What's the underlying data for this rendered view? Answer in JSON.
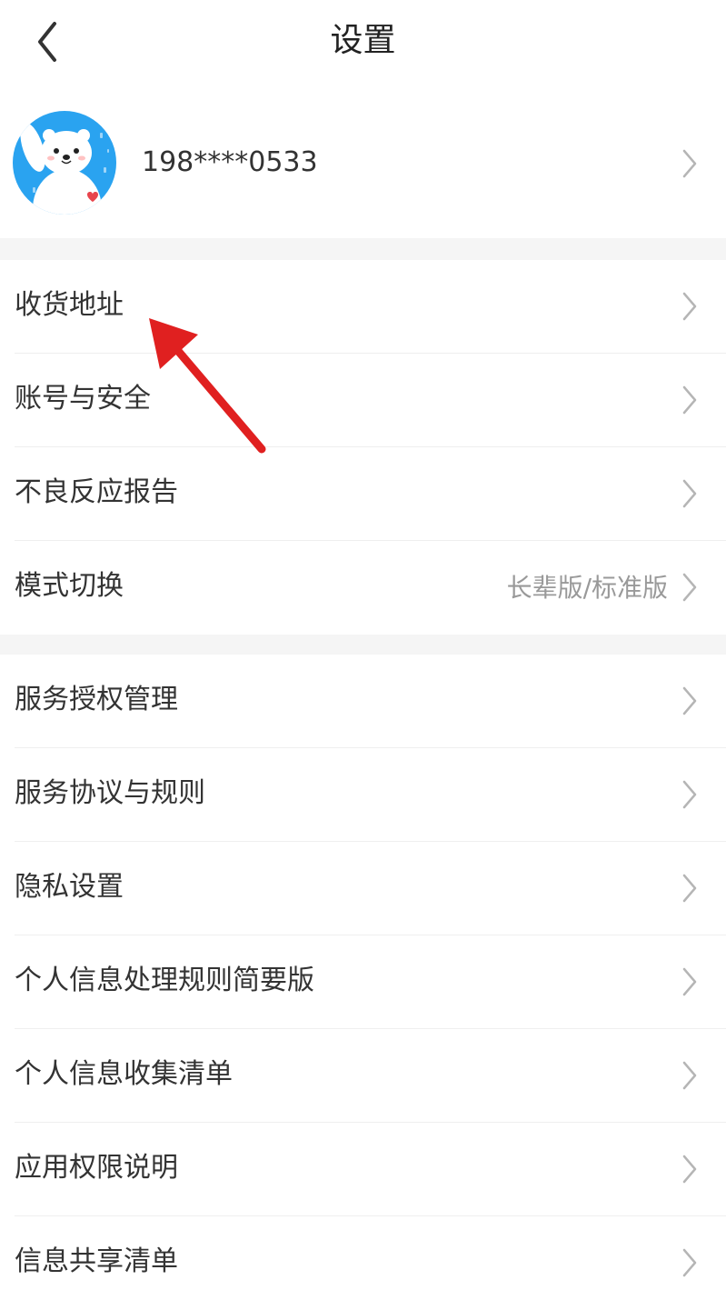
{
  "header": {
    "title": "设置",
    "back_icon": "chevron-left-icon"
  },
  "profile": {
    "phone": "198****0533",
    "avatar": "white-bear-avatar",
    "avatar_bg": "#2aa3f0"
  },
  "group1": [
    {
      "label": "收货地址",
      "value": ""
    },
    {
      "label": "账号与安全",
      "value": ""
    },
    {
      "label": "不良反应报告",
      "value": ""
    },
    {
      "label": "模式切换",
      "value": "长辈版/标准版"
    }
  ],
  "group2": [
    {
      "label": "服务授权管理"
    },
    {
      "label": "服务协议与规则"
    },
    {
      "label": "隐私设置"
    },
    {
      "label": "个人信息处理规则简要版"
    },
    {
      "label": "个人信息收集清单"
    },
    {
      "label": "应用权限说明"
    },
    {
      "label": "信息共享清单"
    }
  ],
  "annotation": {
    "arrow_color": "#e02020"
  },
  "colors": {
    "section_gap": "#f5f5f5",
    "chevron": "#b5b5b5",
    "secondary_text": "#999999"
  }
}
